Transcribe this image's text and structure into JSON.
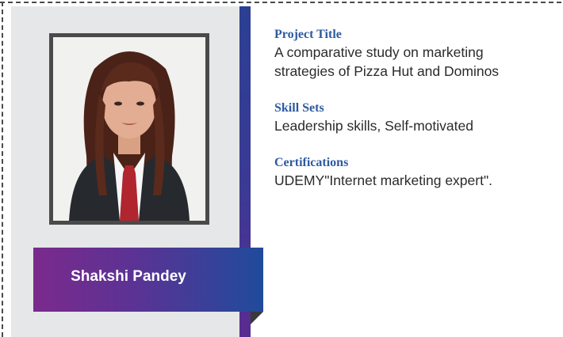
{
  "profile": {
    "name": "Shakshi Pandey",
    "photo_icon": "student-portrait-photo"
  },
  "sections": [
    {
      "heading": "Project Title",
      "lines": [
        "A comparative study on marketing",
        "strategies of Pizza Hut and Dominos"
      ]
    },
    {
      "heading": "Skill Sets",
      "lines": [
        "Leadership skills, Self-motivated"
      ]
    },
    {
      "heading": "Certifications",
      "lines": [
        "UDEMY\"Internet marketing expert\"."
      ]
    }
  ],
  "colors": {
    "heading": "#2e5aa0",
    "banner_start": "#7a2a8c",
    "banner_end": "#1f4b9c",
    "panel": "#e6e7e8"
  }
}
